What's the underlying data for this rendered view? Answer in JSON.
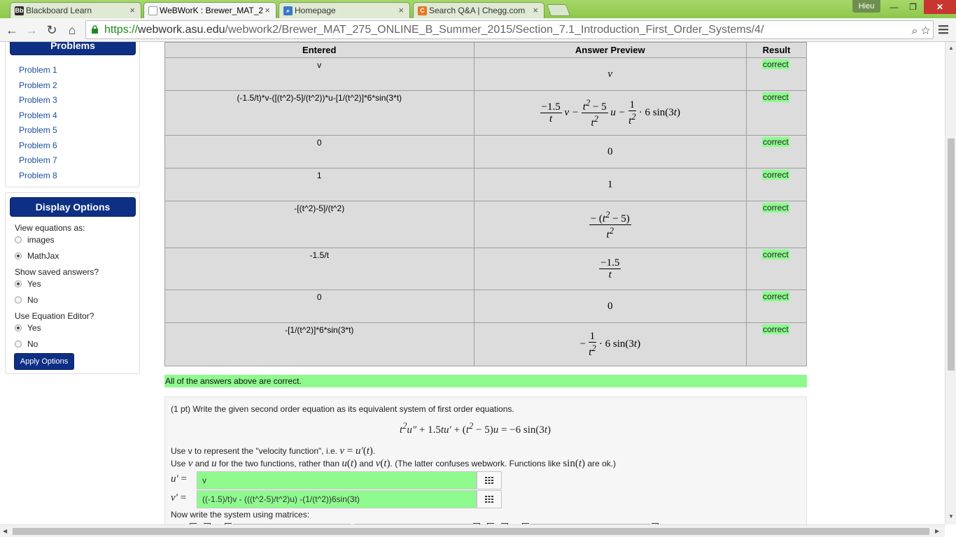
{
  "browser": {
    "tabs": [
      {
        "label": "Blackboard Learn",
        "icon": "blackboard-icon",
        "icon_text": "Bb",
        "color": "#2b2b2b"
      },
      {
        "label": "WeBWorK : Brewer_MAT_2",
        "icon": "page-icon",
        "icon_text": "",
        "color": "#ffffff"
      },
      {
        "label": "Homepage",
        "icon": "search-logo-icon",
        "icon_text": "⌕",
        "color": "#3a78c8"
      },
      {
        "label": "Search Q&A | Chegg.com",
        "icon": "chegg-icon",
        "icon_text": "C",
        "color": "#e87722"
      }
    ],
    "user": "Hieu",
    "url_scheme": "https://",
    "url_host": "webwork.asu.edu",
    "url_path": "/webwork2/Brewer_MAT_275_ONLINE_B_Summer_2015/Section_7.1_Introduction_First_Order_Systems/4/"
  },
  "sidebar": {
    "problems_title": "Problems",
    "problems": [
      "Problem 1",
      "Problem 2",
      "Problem 3",
      "Problem 4",
      "Problem 5",
      "Problem 6",
      "Problem 7",
      "Problem 8"
    ],
    "display_title": "Display Options",
    "view_equations_label": "View equations as:",
    "view_images": "images",
    "view_mathjax": "MathJax",
    "show_saved_label": "Show saved answers?",
    "yes": "Yes",
    "no": "No",
    "use_editor_label": "Use Equation Editor?",
    "apply_label": "Apply Options"
  },
  "results": {
    "headers": [
      "Entered",
      "Answer Preview",
      "Result"
    ],
    "rows": [
      {
        "entered": "v",
        "result": "correct"
      },
      {
        "entered": "(-1.5/t)*v-([(t^2)-5]/(t^2))*u-[1/(t^2)]*6*sin(3*t)",
        "result": "correct"
      },
      {
        "entered": "0",
        "result": "correct"
      },
      {
        "entered": "1",
        "result": "correct"
      },
      {
        "entered": "-[(t^2)-5]/(t^2)",
        "result": "correct"
      },
      {
        "entered": "-1.5/t",
        "result": "correct"
      },
      {
        "entered": "0",
        "result": "correct"
      },
      {
        "entered": "-[1/(t^2)]*6*sin(3*t)",
        "result": "correct"
      }
    ],
    "summary": "All of the answers above are correct."
  },
  "problem": {
    "intro": "(1 pt) Write the given second order equation as its equivalent system of first order equations.",
    "velocity_text_a": "Use v to represent the \"velocity function\", i.e. ",
    "functions_text_a": "Use ",
    "functions_text_b": " and ",
    "functions_text_c": " for the two functions, rather than ",
    "functions_text_d": " and ",
    "functions_text_e": ". (The latter confuses webwork. Functions like ",
    "functions_text_f": " are ok.)",
    "answer1_value": "v",
    "answer2_value": "((-1.5)/t)v - (((t^2-5)/t^2)u) -(1/(t^2))6sin(3t)",
    "matrices_text": "Now write the system using matrices:"
  },
  "colors": {
    "correct": "#8efa8e",
    "header_blue": "#0e2f84",
    "chrome_green": "#8cc84b"
  }
}
